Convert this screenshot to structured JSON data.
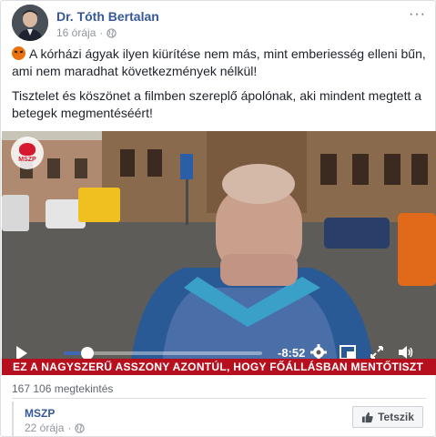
{
  "post": {
    "author": "Dr. Tóth Bertalan",
    "time": "16 órája",
    "dot": "·",
    "more": "···",
    "paragraph1": "A kórházi ágyak ilyen kiürítése nem más, mint emberiesség elleni bűn, ami nem maradhat következmények nélkül!",
    "paragraph2": "Tisztelet és köszönet a filmben szereplő ápolónak, aki mindent megtett a betegek megmentéséért!"
  },
  "video": {
    "logo_text": "MSZP",
    "remaining_time": "-8:52",
    "progress": 0.12,
    "subtitle": "EZ A NAGYSZERŰ ASSZONY AZONTÚL, HOGY FŐÁLLÁSBAN MENTŐTISZT",
    "accent_color": "#4267b2"
  },
  "stats": {
    "views": "167 106 megtekintés"
  },
  "shared": {
    "name": "MSZP",
    "time": "22 órája",
    "dot": "·",
    "like_label": "Tetszik"
  },
  "icons": {
    "privacy": "globe-icon",
    "like": "thumbs-up-icon",
    "settings": "gear-icon",
    "pip": "picture-in-picture-icon",
    "fullscreen": "expand-icon",
    "volume": "volume-icon"
  }
}
